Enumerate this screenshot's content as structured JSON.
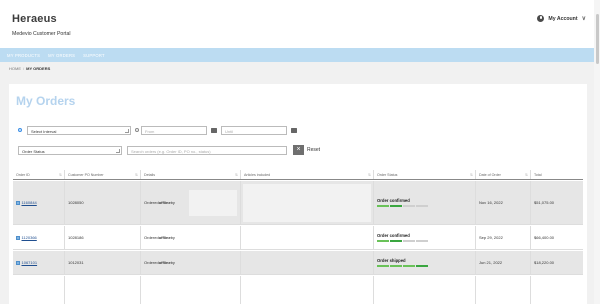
{
  "header": {
    "logo": "Heraeus",
    "portal": "Medevio Customer Portal",
    "account_label": "My Account",
    "account_chevron": "∨"
  },
  "nav": {
    "items": [
      "MY PRODUCTS",
      "MY ORDERS",
      "SUPPORT"
    ]
  },
  "breadcrumb": {
    "home": "HOME",
    "separator": "/",
    "current": "MY ORDERS"
  },
  "page": {
    "title": "My Orders"
  },
  "filters": {
    "select_interval": "Select Interval",
    "from_placeholder": "From",
    "until_placeholder": "Until",
    "order_status": "Order Status",
    "search_placeholder": "Search orders (e.g. Order ID, PO no., status)",
    "reset_icon": "×",
    "reset_label": "Reset"
  },
  "table": {
    "columns": [
      "Order ID",
      "Customer PO Number",
      "Details",
      "Articles included",
      "Order Status",
      "Date of Order",
      "Total"
    ],
    "rows": [
      {
        "id": "1160844",
        "po": "1028050",
        "details_prefix": "Ordered ",
        "details_bold": "offline",
        "details_suffix": " by",
        "status": "Order confirmed",
        "date": "Nov 16, 2022",
        "total": "$51,075.00"
      },
      {
        "id": "1120366",
        "po": "1028186",
        "details_prefix": "Ordered ",
        "details_bold": "offline",
        "details_suffix": " by",
        "status": "Order confirmed",
        "date": "Sep 29, 2022",
        "total": "$66,400.00"
      },
      {
        "id": "1067101",
        "po": "1012031",
        "details_prefix": "Ordered ",
        "details_bold": "offline",
        "details_suffix": " by",
        "status": "Order shipped",
        "date": "Jun 21, 2022",
        "total": "$18,220.00"
      }
    ]
  },
  "colors": {
    "accent": "#3a8ee6",
    "nav_bar": "#bcdcf2",
    "title": "#b5d3ee",
    "progress_done": "#6ac259",
    "progress_pending": "#cfcfcf"
  }
}
